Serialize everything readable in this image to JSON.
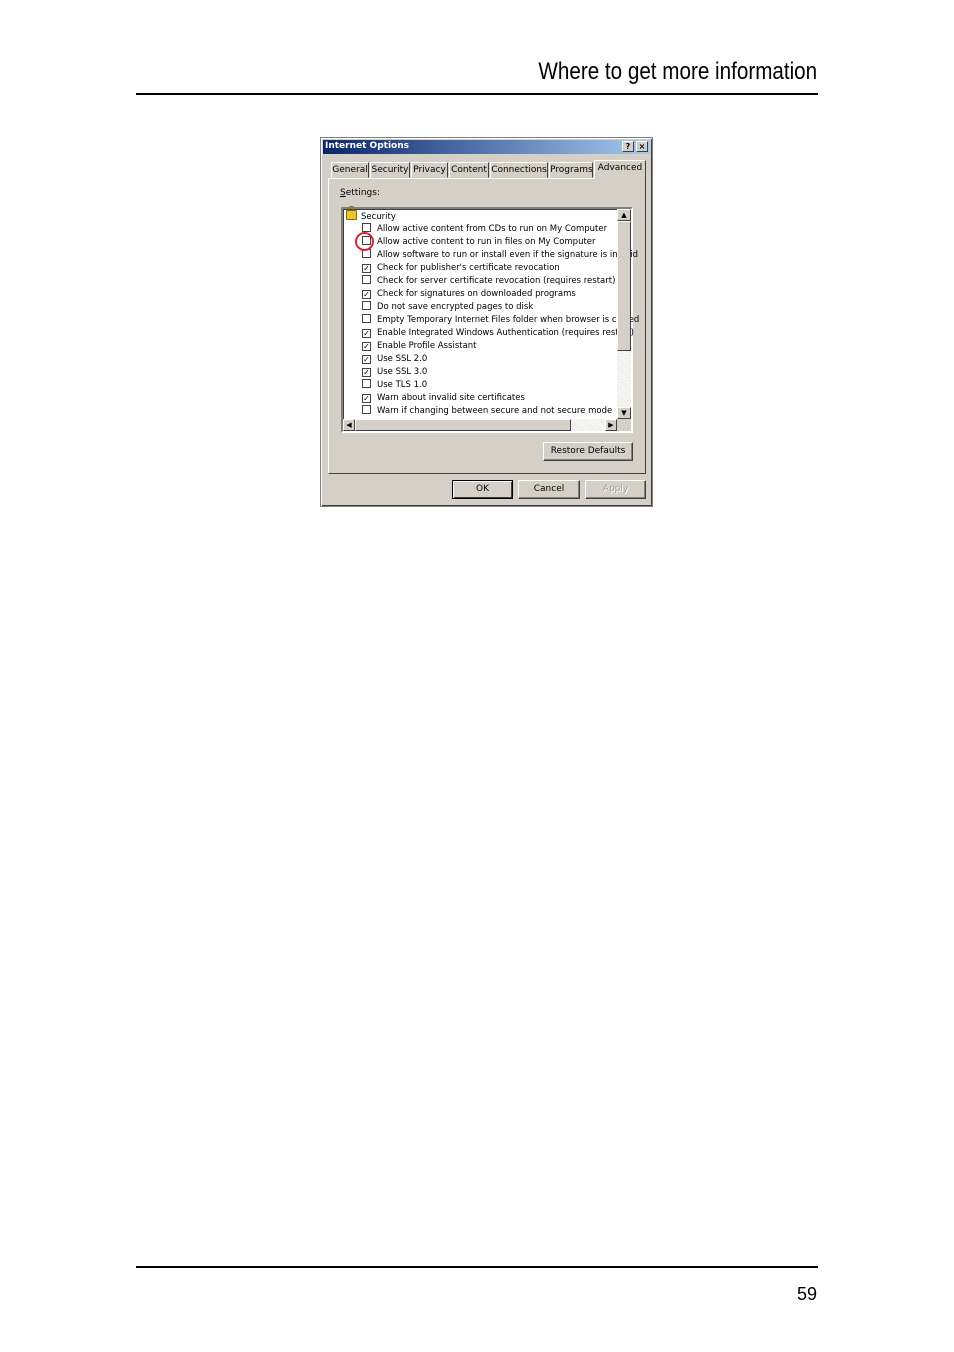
{
  "page": {
    "header_title": "Where to get more information",
    "page_number": "59"
  },
  "dialog": {
    "title": "Internet Options",
    "help_glyph": "?",
    "close_glyph": "×",
    "tabs": [
      {
        "label": "General"
      },
      {
        "label": "Security"
      },
      {
        "label": "Privacy"
      },
      {
        "label": "Content"
      },
      {
        "label": "Connections"
      },
      {
        "label": "Programs"
      },
      {
        "label": "Advanced",
        "active": true
      }
    ],
    "settings_label_mnemonic": "S",
    "settings_label_rest": "ettings:",
    "category": "Security",
    "highlighted_item_index": 1,
    "items": [
      {
        "label": "Allow active content from CDs to run on My Computer",
        "checked": false
      },
      {
        "label": "Allow active content to run in files on My Computer",
        "checked": false
      },
      {
        "label": "Allow software to run or install even if the signature is invalid",
        "checked": false
      },
      {
        "label": "Check for publisher's certificate revocation",
        "checked": true
      },
      {
        "label": "Check for server certificate revocation (requires restart)",
        "checked": false
      },
      {
        "label": "Check for signatures on downloaded programs",
        "checked": true
      },
      {
        "label": "Do not save encrypted pages to disk",
        "checked": false
      },
      {
        "label": "Empty Temporary Internet Files folder when browser is closed",
        "checked": false
      },
      {
        "label": "Enable Integrated Windows Authentication (requires restart)",
        "checked": true
      },
      {
        "label": "Enable Profile Assistant",
        "checked": true
      },
      {
        "label": "Use SSL 2.0",
        "checked": true
      },
      {
        "label": "Use SSL 3.0",
        "checked": true
      },
      {
        "label": "Use TLS 1.0",
        "checked": false
      },
      {
        "label": "Warn about invalid site certificates",
        "checked": true
      },
      {
        "label": "Warn if changing between secure and not secure mode",
        "checked": false
      }
    ],
    "check_glyph": "✓",
    "scroll_up_glyph": "▲",
    "scroll_down_glyph": "▼",
    "scroll_left_glyph": "◀",
    "scroll_right_glyph": "▶",
    "restore_defaults_label": "Restore Defaults",
    "ok_label": "OK",
    "cancel_label": "Cancel",
    "apply_label": "Apply",
    "apply_enabled": false,
    "colors": {
      "face": "#d4d0c8",
      "titlebar_start": "#0a246a",
      "titlebar_end": "#a6caf0",
      "highlight_circle": "#d9262c"
    }
  }
}
